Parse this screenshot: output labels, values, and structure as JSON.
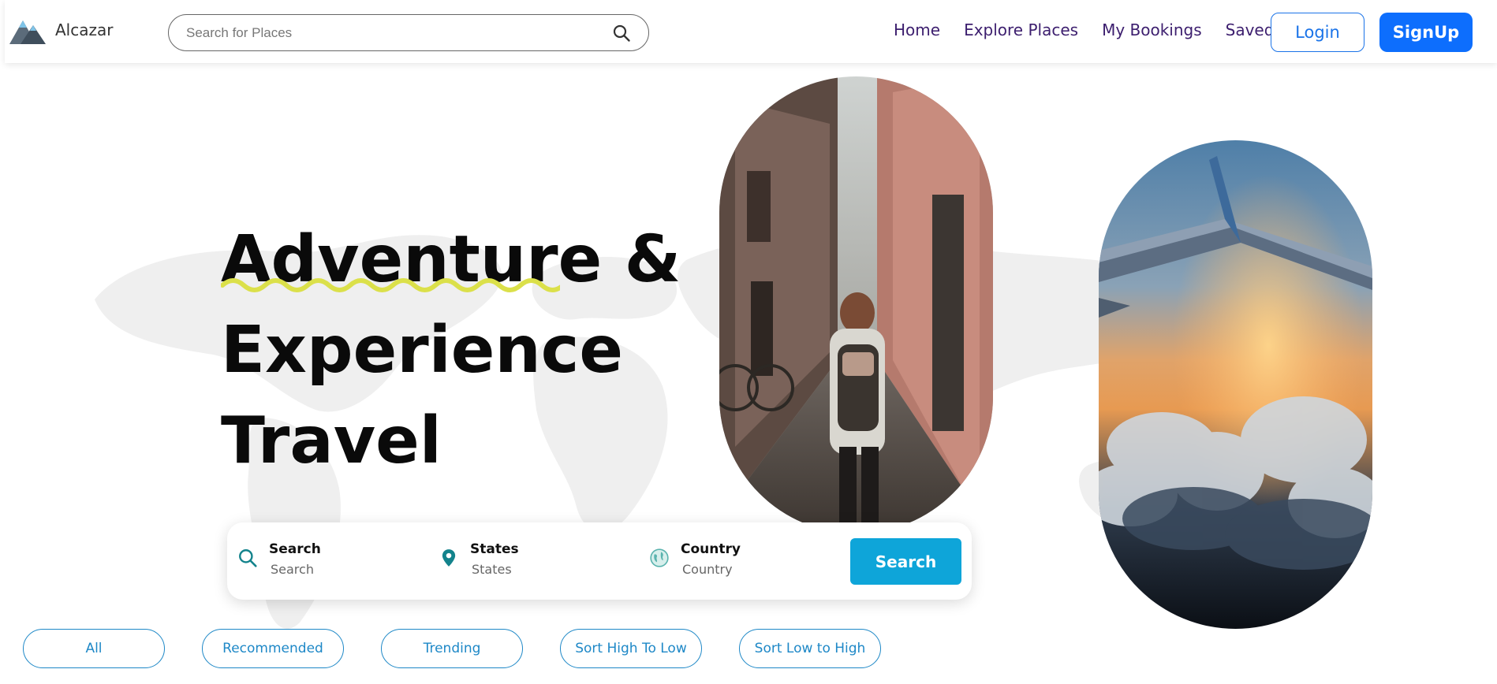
{
  "brand": {
    "name": "Alcazar",
    "logo_icon": "mountain-logo-icon"
  },
  "top_search": {
    "placeholder": "Search for Places",
    "icon": "search-icon"
  },
  "nav": {
    "links": [
      "Home",
      "Explore Places",
      "My Bookings",
      "Saved"
    ],
    "login_label": "Login",
    "signup_label": "SignUp"
  },
  "hero": {
    "lines": [
      "Adventure &",
      "Experience",
      "Travel"
    ],
    "images": [
      "alley-traveler-photo",
      "airplane-wing-clouds-photo"
    ]
  },
  "search_panel": {
    "fields": [
      {
        "label": "Search",
        "value": "Search",
        "icon": "search-icon"
      },
      {
        "label": "States",
        "value": "States",
        "icon": "location-pin-icon"
      },
      {
        "label": "Country",
        "value": "Country",
        "icon": "globe-icon"
      }
    ],
    "button_label": "Search"
  },
  "filters": [
    "All",
    "Recommended",
    "Trending",
    "Sort High To Low",
    "Sort Low to High"
  ],
  "colors": {
    "nav_link": "#3c1e6e",
    "primary_blue": "#0d6efd",
    "search_button": "#0ea5d9",
    "chip_border": "#1e88c7",
    "squiggle": "#dbe04a"
  }
}
